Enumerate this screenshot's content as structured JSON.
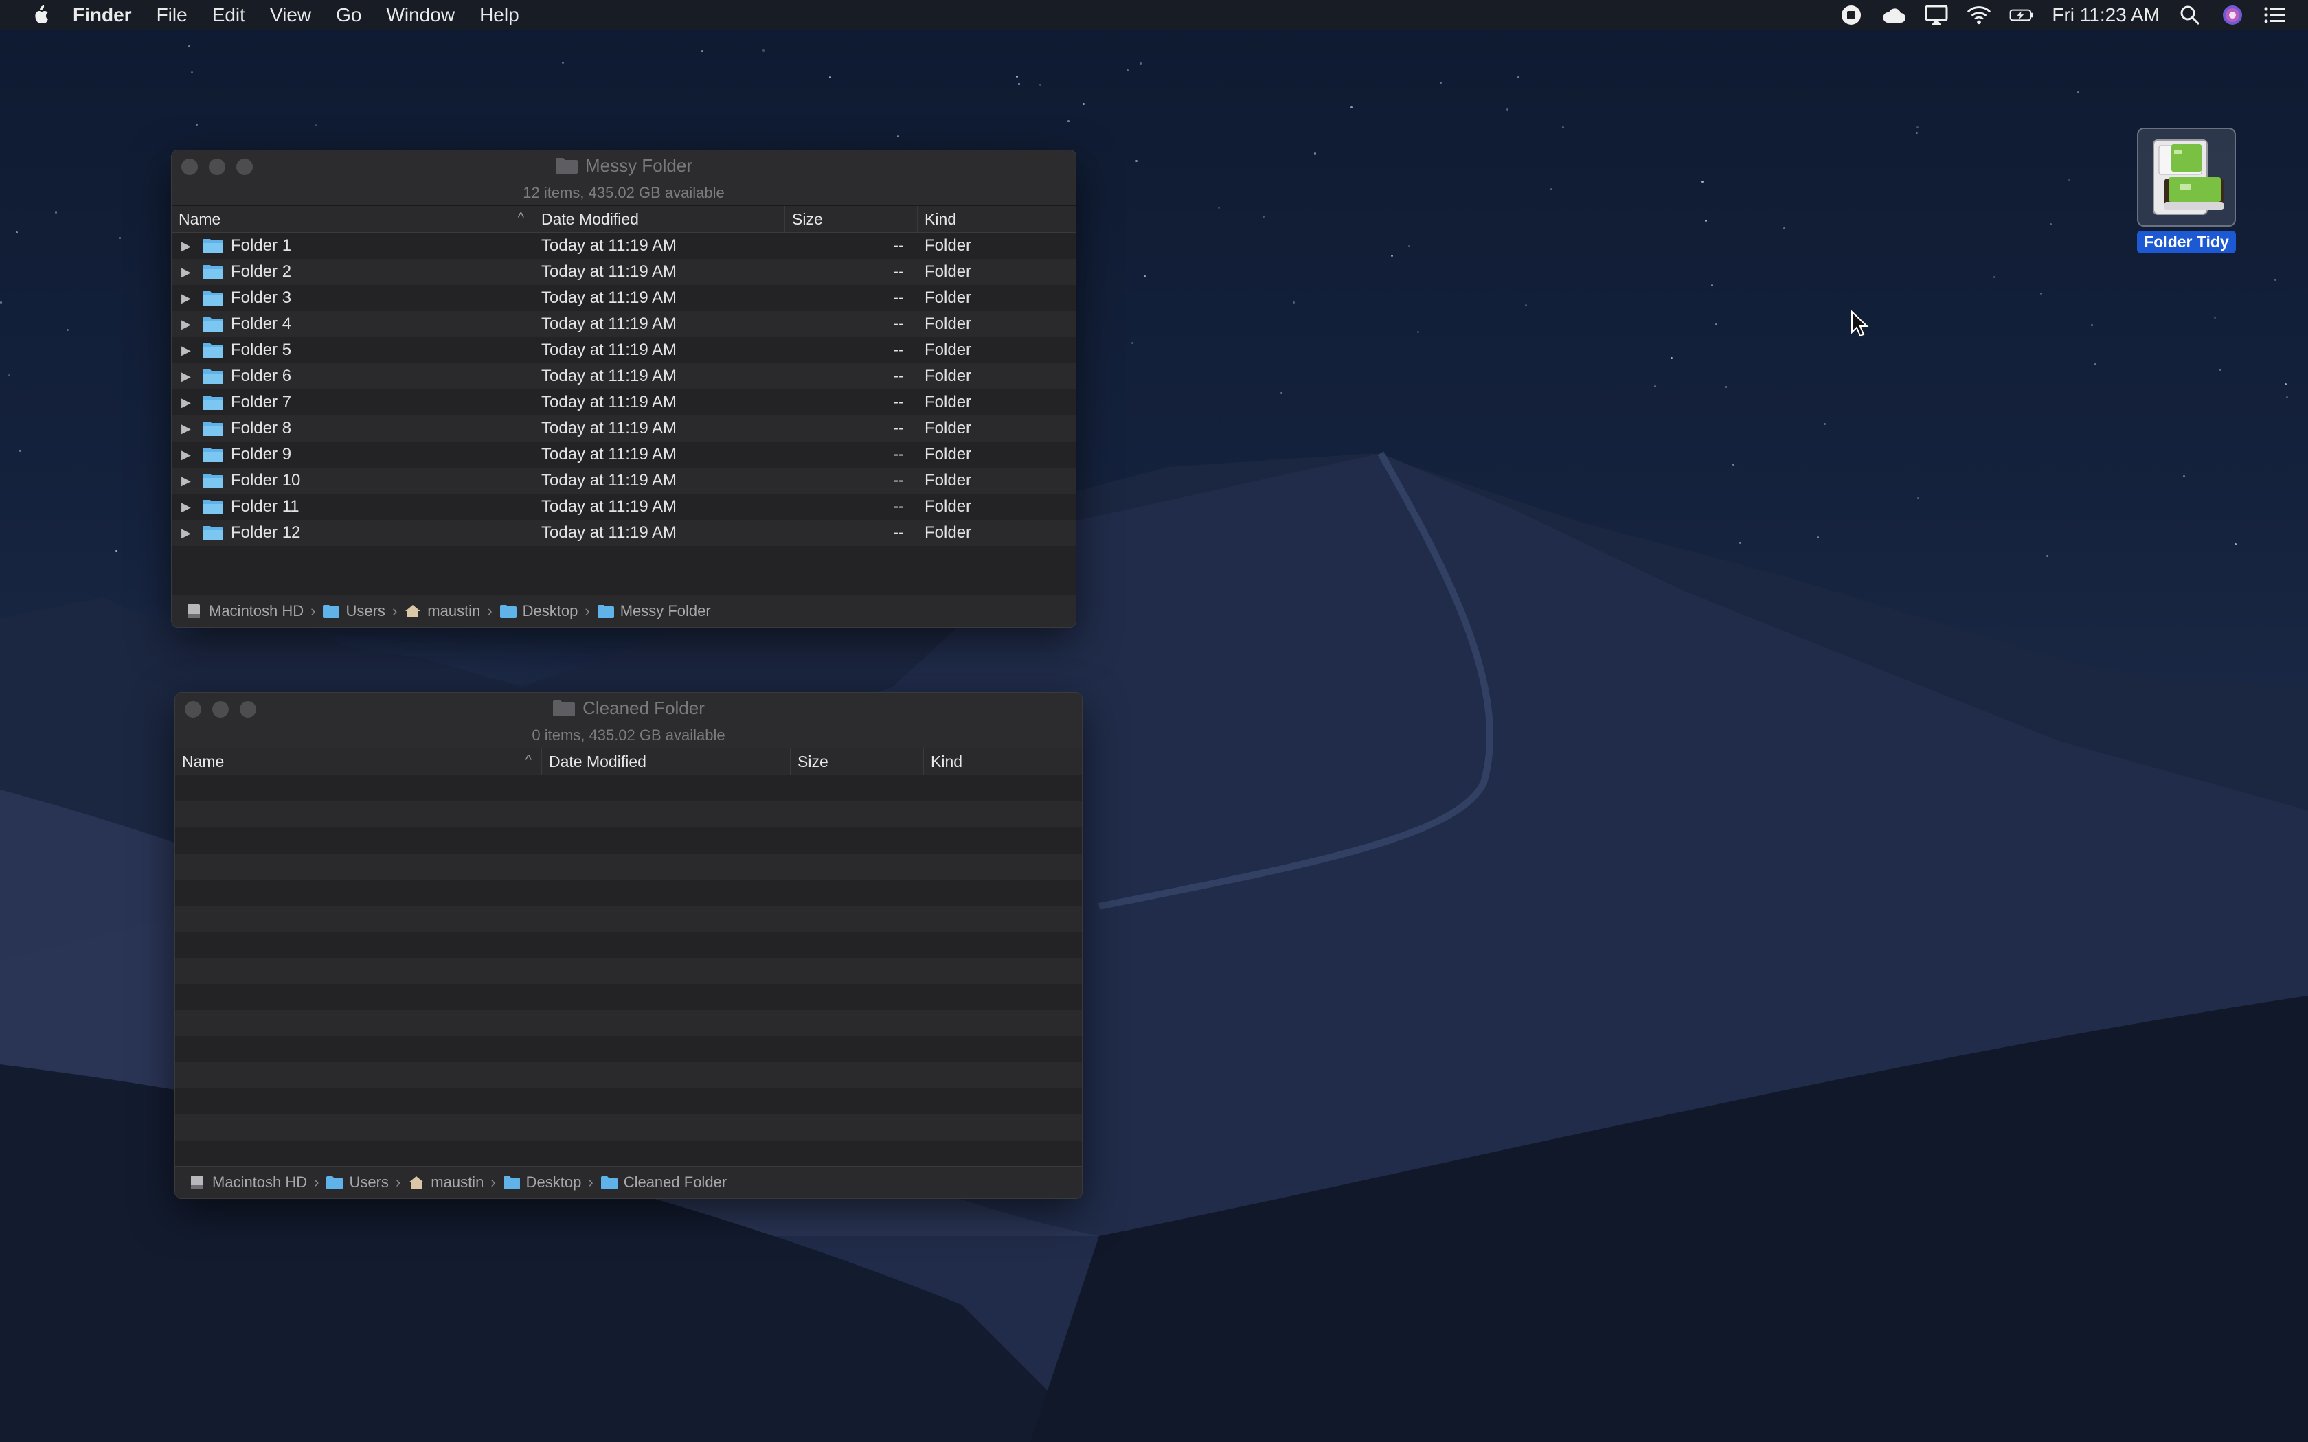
{
  "menubar": {
    "app": "Finder",
    "items": [
      "File",
      "Edit",
      "View",
      "Go",
      "Window",
      "Help"
    ],
    "clock": "Fri 11:23 AM",
    "status_icons": [
      "record-icon",
      "cloud-icon",
      "airplay-icon",
      "wifi-icon",
      "battery-icon",
      "spotlight-icon",
      "siri-icon",
      "notification-center-icon"
    ]
  },
  "windows": {
    "messy": {
      "title": "Messy Folder",
      "status": "12 items, 435.02 GB available",
      "columns": [
        "Name",
        "Date Modified",
        "Size",
        "Kind"
      ],
      "rows": [
        {
          "name": "Folder 1",
          "date": "Today at 11:19 AM",
          "size": "--",
          "kind": "Folder"
        },
        {
          "name": "Folder 2",
          "date": "Today at 11:19 AM",
          "size": "--",
          "kind": "Folder"
        },
        {
          "name": "Folder 3",
          "date": "Today at 11:19 AM",
          "size": "--",
          "kind": "Folder"
        },
        {
          "name": "Folder 4",
          "date": "Today at 11:19 AM",
          "size": "--",
          "kind": "Folder"
        },
        {
          "name": "Folder 5",
          "date": "Today at 11:19 AM",
          "size": "--",
          "kind": "Folder"
        },
        {
          "name": "Folder 6",
          "date": "Today at 11:19 AM",
          "size": "--",
          "kind": "Folder"
        },
        {
          "name": "Folder 7",
          "date": "Today at 11:19 AM",
          "size": "--",
          "kind": "Folder"
        },
        {
          "name": "Folder 8",
          "date": "Today at 11:19 AM",
          "size": "--",
          "kind": "Folder"
        },
        {
          "name": "Folder 9",
          "date": "Today at 11:19 AM",
          "size": "--",
          "kind": "Folder"
        },
        {
          "name": "Folder 10",
          "date": "Today at 11:19 AM",
          "size": "--",
          "kind": "Folder"
        },
        {
          "name": "Folder 11",
          "date": "Today at 11:19 AM",
          "size": "--",
          "kind": "Folder"
        },
        {
          "name": "Folder 12",
          "date": "Today at 11:19 AM",
          "size": "--",
          "kind": "Folder"
        }
      ],
      "path": [
        "Macintosh HD",
        "Users",
        "maustin",
        "Desktop",
        "Messy Folder"
      ]
    },
    "cleaned": {
      "title": "Cleaned Folder",
      "status": "0 items, 435.02 GB available",
      "columns": [
        "Name",
        "Date Modified",
        "Size",
        "Kind"
      ],
      "path": [
        "Macintosh HD",
        "Users",
        "maustin",
        "Desktop",
        "Cleaned Folder"
      ]
    }
  },
  "desktop": {
    "icon_label": "Folder Tidy"
  },
  "colors": {
    "accent": "#1c59d2",
    "folder": "#5fb3e8"
  }
}
